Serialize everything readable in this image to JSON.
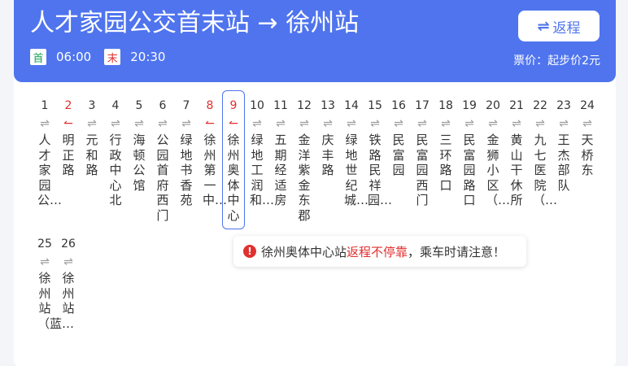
{
  "header": {
    "title": "人才家园公交首末站 → 徐州站",
    "return_icon": "⇌",
    "return_label": "返程",
    "first_badge": "首",
    "first_time": "06:00",
    "last_badge": "末",
    "last_time": "20:30",
    "fare": "票价：起步价2元"
  },
  "stops": [
    {
      "num": "1",
      "name": "人才家园公…",
      "arrow": "⇌",
      "style": "normal"
    },
    {
      "num": "2",
      "name": "明正路",
      "arrow": "↼",
      "style": "red"
    },
    {
      "num": "3",
      "name": "元和路",
      "arrow": "⇌",
      "style": "normal"
    },
    {
      "num": "4",
      "name": "行政中心北",
      "arrow": "⇌",
      "style": "normal"
    },
    {
      "num": "5",
      "name": "海顿公馆",
      "arrow": "⇌",
      "style": "normal"
    },
    {
      "num": "6",
      "name": "公园首府西门",
      "arrow": "⇌",
      "style": "normal"
    },
    {
      "num": "7",
      "name": "绿地书香苑",
      "arrow": "⇌",
      "style": "normal"
    },
    {
      "num": "8",
      "name": "徐州第一中…",
      "arrow": "↼",
      "style": "red"
    },
    {
      "num": "9",
      "name": "徐州奥体中心",
      "arrow": "↼",
      "style": "current"
    },
    {
      "num": "10",
      "name": "绿地工润和…",
      "arrow": "⇌",
      "style": "normal"
    },
    {
      "num": "11",
      "name": "五期经适房",
      "arrow": "⇌",
      "style": "normal"
    },
    {
      "num": "12",
      "name": "金洋紫金东郡",
      "arrow": "⇌",
      "style": "normal"
    },
    {
      "num": "13",
      "name": "庆丰路",
      "arrow": "⇌",
      "style": "normal"
    },
    {
      "num": "14",
      "name": "绿地世纪城…",
      "arrow": "⇌",
      "style": "normal"
    },
    {
      "num": "15",
      "name": "铁路民祥园…",
      "arrow": "⇌",
      "style": "normal"
    },
    {
      "num": "16",
      "name": "民富园",
      "arrow": "⇌",
      "style": "normal"
    },
    {
      "num": "17",
      "name": "民富园西门",
      "arrow": "⇌",
      "style": "normal"
    },
    {
      "num": "18",
      "name": "三环路口",
      "arrow": "⇌",
      "style": "normal"
    },
    {
      "num": "19",
      "name": "民富园路口",
      "arrow": "⇌",
      "style": "normal"
    },
    {
      "num": "20",
      "name": "金狮小区（…",
      "arrow": "⇌",
      "style": "normal"
    },
    {
      "num": "21",
      "name": "黄山干休所",
      "arrow": "⇌",
      "style": "normal"
    },
    {
      "num": "22",
      "name": "九七医院（…",
      "arrow": "⇌",
      "style": "normal"
    },
    {
      "num": "23",
      "name": "王杰部队",
      "arrow": "⇌",
      "style": "normal"
    },
    {
      "num": "24",
      "name": "天桥东",
      "arrow": "⇌",
      "style": "normal"
    },
    {
      "num": "25",
      "name": "徐州站（蓝…",
      "arrow": "⇌",
      "style": "normal"
    },
    {
      "num": "26",
      "name": "徐州站",
      "arrow": "⇌",
      "style": "normal"
    }
  ],
  "notice": {
    "icon": "!",
    "prefix": "徐州奥体中心站",
    "highlight": "返程不停靠",
    "suffix": "，乘车时请注意！"
  },
  "colors": {
    "accent": "#4f74ee",
    "warning": "#e03030",
    "first_badge": "#18a058"
  }
}
